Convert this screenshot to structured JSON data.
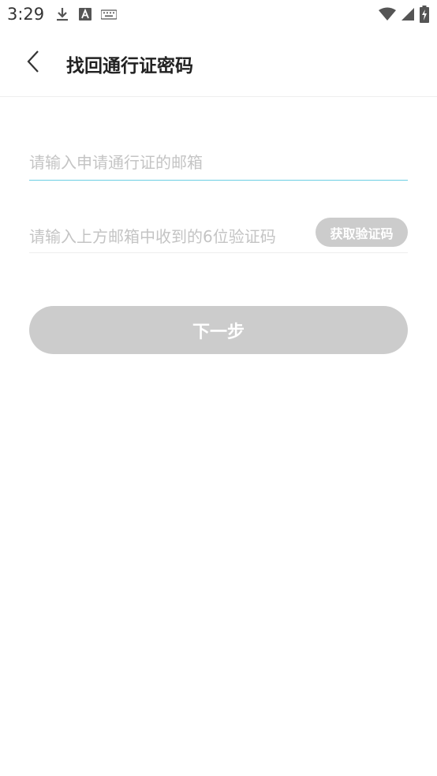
{
  "status_bar": {
    "time": "3:29",
    "left_icons": [
      "download-icon",
      "a-box-icon",
      "keyboard-icon"
    ],
    "right_icons": [
      "wifi-icon",
      "signal-icon",
      "battery-charging-icon"
    ]
  },
  "header": {
    "back_icon": "chevron-left-icon",
    "title": "找回通行证密码"
  },
  "form": {
    "email_placeholder": "请输入申请通行证的邮箱",
    "email_value": "",
    "code_placeholder": "请输入上方邮箱中收到的6位验证码",
    "code_value": "",
    "get_code_label": "获取验证码",
    "next_label": "下一步"
  },
  "colors": {
    "accent_underline": "#6ccfe3",
    "disabled_button": "#cccccc"
  }
}
